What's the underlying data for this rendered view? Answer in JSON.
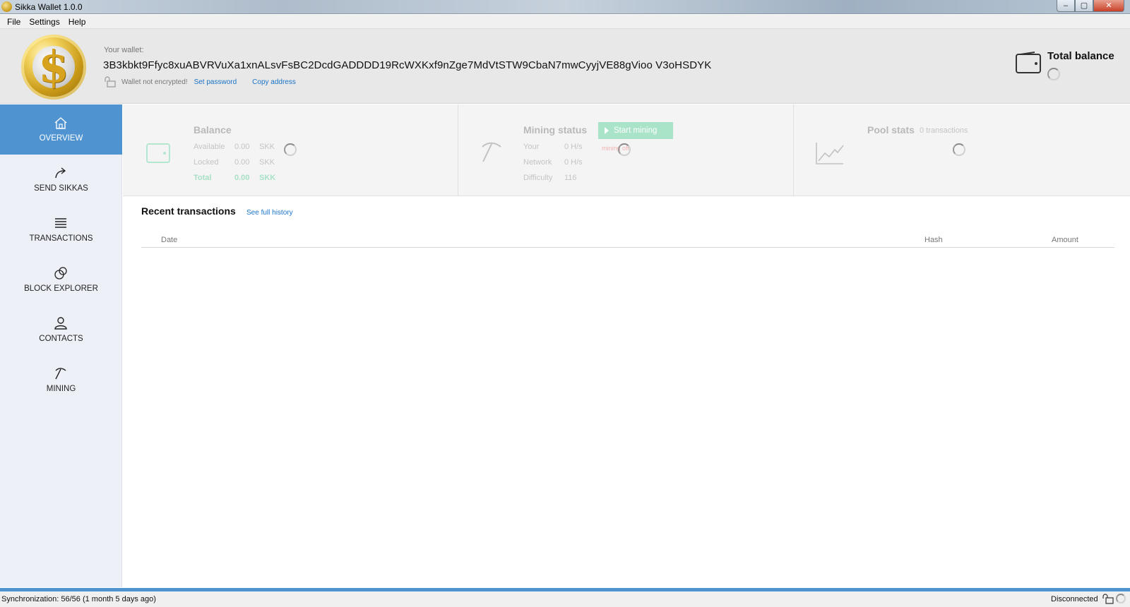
{
  "window": {
    "title": "Sikka Wallet 1.0.0",
    "controls": {
      "minimize": "–",
      "maximize": "▢",
      "close": "✕"
    }
  },
  "menu": [
    "File",
    "Settings",
    "Help"
  ],
  "header": {
    "wallet_label": "Your wallet:",
    "address": "3B3kbkt9Ffyc8xuABVRVuXa1xnALsvFsBC2DcdGADDDD19RcWXKxf9nZge7MdVtSTW9CbaN7mwCyyjVE88gVioo V3oHSDYK",
    "encryption_status": "Wallet not encrypted!",
    "set_password": "Set password",
    "copy_address": "Copy address",
    "total_balance_label": "Total balance"
  },
  "sidebar": {
    "items": [
      {
        "label": "OVERVIEW",
        "icon": "home-icon",
        "active": true
      },
      {
        "label": "SEND SIKKAS",
        "icon": "send-arrow-icon",
        "active": false
      },
      {
        "label": "TRANSACTIONS",
        "icon": "list-icon",
        "active": false
      },
      {
        "label": "BLOCK EXPLORER",
        "icon": "explorer-circles-icon",
        "active": false
      },
      {
        "label": "CONTACTS",
        "icon": "person-icon",
        "active": false
      },
      {
        "label": "MINING",
        "icon": "pickaxe-icon",
        "active": false
      }
    ]
  },
  "balance": {
    "title": "Balance",
    "rows": [
      {
        "label": "Available",
        "value": "0.00",
        "unit": "SKK"
      },
      {
        "label": "Locked",
        "value": "0.00",
        "unit": "SKK"
      },
      {
        "label": "Total",
        "value": "0.00",
        "unit": "SKK"
      }
    ]
  },
  "mining": {
    "title": "Mining status",
    "start_button": "Start mining",
    "state": "mining off",
    "rows": [
      {
        "label": "Your",
        "value": "0 H/s"
      },
      {
        "label": "Network",
        "value": "0 H/s"
      },
      {
        "label": "Difficulty",
        "value": "116"
      }
    ]
  },
  "pool": {
    "title": "Pool stats",
    "subtitle": "0 transactions"
  },
  "recent": {
    "title": "Recent transactions",
    "full_history_link": "See full history",
    "columns": {
      "date": "Date",
      "hash": "Hash",
      "amount": "Amount"
    },
    "rows": []
  },
  "status": {
    "sync": "Synchronization: 56/56 (1 month 5 days ago)",
    "connection": "Disconnected"
  },
  "colors": {
    "accent": "#4f93d1",
    "start_button": "#a9e3c8",
    "link": "#1a73c8"
  }
}
